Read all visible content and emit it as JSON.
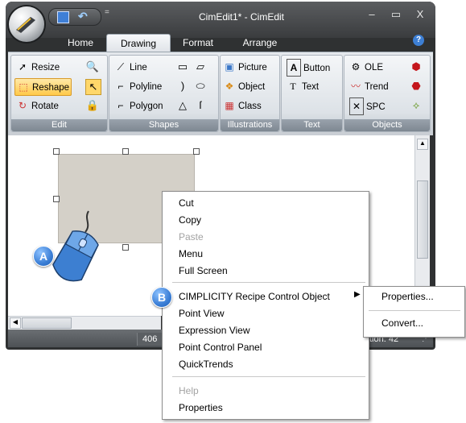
{
  "window": {
    "title": "CimEdit1* - CimEdit",
    "controls": [
      "–",
      "▭",
      "X"
    ],
    "qat_more": "="
  },
  "tabs": [
    {
      "label": "Home"
    },
    {
      "label": "Drawing",
      "active": true
    },
    {
      "label": "Format"
    },
    {
      "label": "Arrange"
    }
  ],
  "ribbon": {
    "edit": {
      "label": "Edit",
      "resize": "Resize",
      "reshape": "Reshape",
      "rotate": "Rotate"
    },
    "shapes": {
      "label": "Shapes",
      "line": "Line",
      "polyline": "Polyline",
      "polygon": "Polygon"
    },
    "illustrations": {
      "label": "Illustrations",
      "picture": "Picture",
      "object": "Object",
      "class": "Class"
    },
    "text": {
      "label": "Text",
      "button": "Button",
      "text": "Text"
    },
    "objects": {
      "label": "Objects",
      "ole": "OLE",
      "trend": "Trend",
      "spc": "SPC"
    }
  },
  "status": {
    "left": "406",
    "right": "tion: 42"
  },
  "callouts": {
    "a": "A",
    "b": "B"
  },
  "context_menu": {
    "items": [
      {
        "label": "Cut",
        "enabled": true
      },
      {
        "label": "Copy",
        "enabled": true
      },
      {
        "label": "Paste",
        "enabled": false
      },
      {
        "label": "Menu",
        "enabled": true
      },
      {
        "label": "Full Screen",
        "enabled": true
      },
      {
        "label": "CIMPLICITY Recipe Control Object",
        "enabled": true,
        "submenu": true
      },
      {
        "label": "Point View",
        "enabled": true
      },
      {
        "label": "Expression View",
        "enabled": true
      },
      {
        "label": "Point Control Panel",
        "enabled": true
      },
      {
        "label": "QuickTrends",
        "enabled": true
      },
      {
        "label": "Help",
        "enabled": false
      },
      {
        "label": "Properties",
        "enabled": true
      }
    ]
  },
  "submenu": {
    "items": [
      {
        "label": "Properties..."
      },
      {
        "label": "Convert..."
      }
    ]
  },
  "colors": {
    "frame": "#2f3132",
    "ribbon": "#dde2e7",
    "highlight": "#ffc94a",
    "callout": "#3c7fd6",
    "shape_fill": "#d4d0c8"
  }
}
